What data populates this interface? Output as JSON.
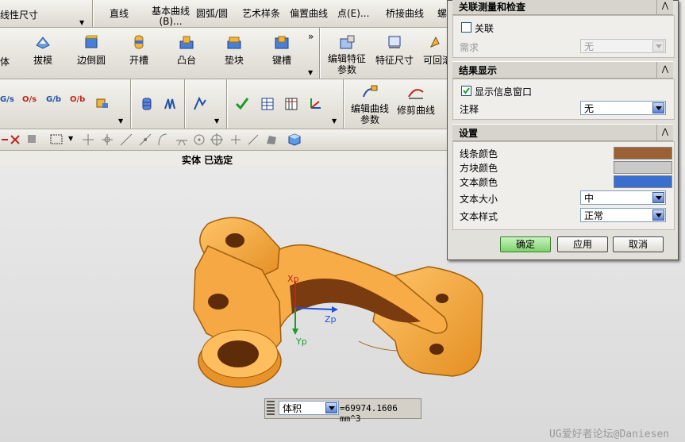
{
  "toolbar_row1": {
    "items": [
      "线性尺寸",
      "直线",
      "基本曲线(B)...",
      "圆弧/圆",
      "艺术样条",
      "偏置曲线",
      "点(E)...",
      "桥接曲线",
      "螺"
    ]
  },
  "toolbar_row2": {
    "items": [
      "体",
      "拔模",
      "边倒圆",
      "开槽",
      "凸台",
      "垫块",
      "键槽",
      "编辑特征参数",
      "特征尺寸",
      "可回滚编辑"
    ]
  },
  "toolbar_row3": {
    "icons": [
      "G/s",
      "O/s",
      "G/b",
      "O/b"
    ],
    "items": [
      "编辑曲线参数",
      "修剪曲线"
    ]
  },
  "selection_bar": {
    "status": "实体 已选定"
  },
  "dialog": {
    "section1": {
      "title": "关联测量和检查",
      "checkbox_label": "关联",
      "checked": false,
      "req_label": "需求",
      "req_value": "无"
    },
    "section2": {
      "title": "结果显示",
      "checkbox_label": "显示信息窗口",
      "checked": true,
      "note_label": "注释",
      "note_value": "无"
    },
    "section3": {
      "title": "设置",
      "line_color_label": "线条颜色",
      "line_color": "#9b6034",
      "block_color_label": "方块颜色",
      "block_color": "#c9c9c9",
      "text_color_label": "文本颜色",
      "text_color": "#3a6fd0",
      "text_size_label": "文本大小",
      "text_size_value": "中",
      "text_style_label": "文本样式",
      "text_style_value": "正常"
    },
    "ok_label": "确定",
    "apply_label": "应用",
    "cancel_label": "取消"
  },
  "model": {
    "part_color": "#f5a843",
    "axes": {
      "xp": "Xp",
      "yp": "Yp",
      "zp": "Zp"
    }
  },
  "measure_bar": {
    "type_value": "体积",
    "result": "=69974.1606 mm^3"
  },
  "watermark": "UG爱好者论坛@Daniesen"
}
